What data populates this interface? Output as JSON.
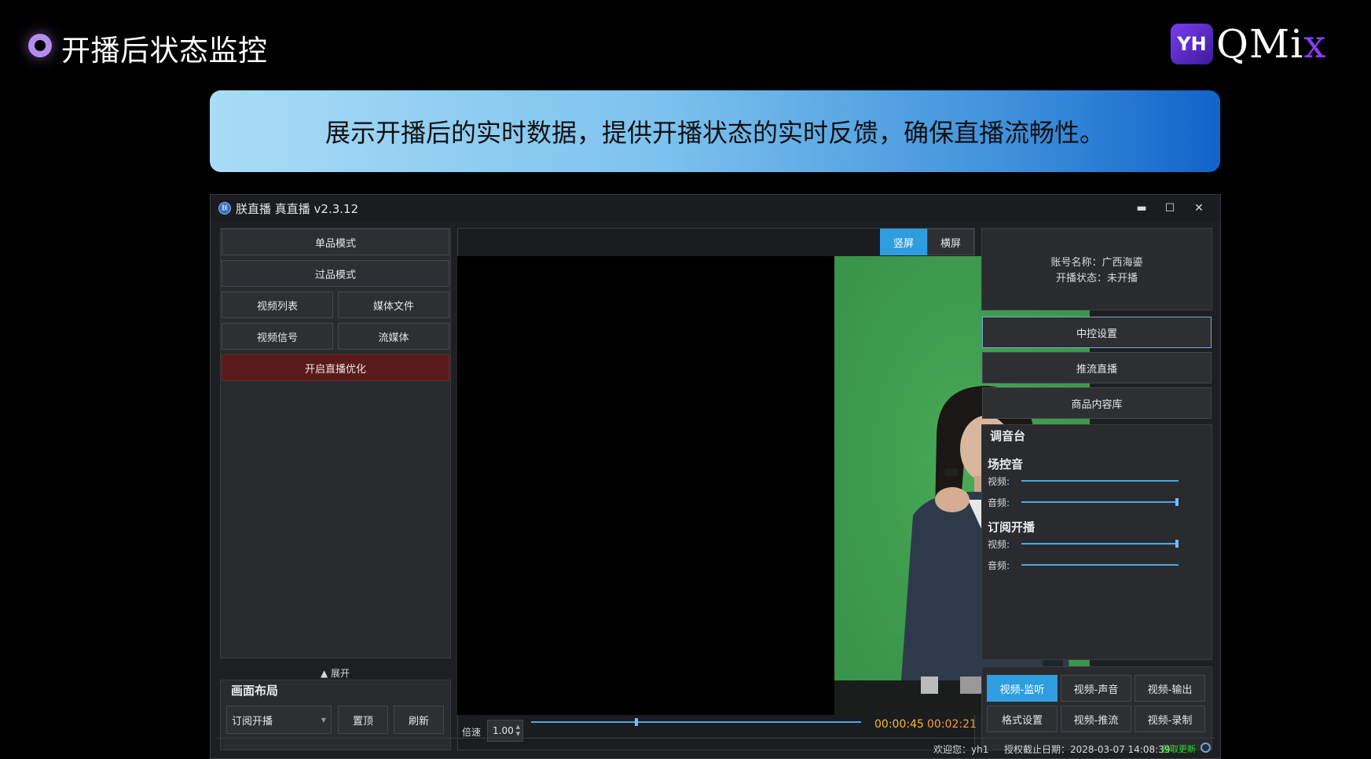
{
  "slide": {
    "title": "开播后状态监控",
    "logo_mark": "YH",
    "logo_text": "QMi",
    "logo_x": "x",
    "banner": "展示开播后的实时数据，提供开播状态的实时反馈，确保直播流畅性。"
  },
  "window": {
    "title": "朕直播 真直播 v2.3.12",
    "icon_label": "朕",
    "minimize": "▬",
    "maximize": "☐",
    "close": "✕"
  },
  "left": {
    "buttons": [
      "单品模式",
      "过品模式",
      "视频列表",
      "媒体文件",
      "视频信号",
      "流媒体",
      "开启直播优化"
    ],
    "expand": "▲ 展开",
    "layout_title": "画面布局",
    "layout_select": "订阅开播",
    "top_button": "置顶",
    "refresh_button": "刷新"
  },
  "center": {
    "tab_portrait": "竖屏",
    "tab_landscape": "横屏",
    "speed_label": "倍速",
    "speed_value": "1.00",
    "time_current": "00:00:45",
    "time_total": "00:02:21",
    "progress": 0.32
  },
  "right": {
    "account_line": "账号名称：广西海鎏",
    "status_line": "开播状态：未开播",
    "buttons": [
      "中控设置",
      "推流直播",
      "商品内容库"
    ],
    "mixer_title": "调音台",
    "groups": [
      {
        "name": "场控音",
        "video_label": "视频:",
        "video_level": 0.0,
        "audio_label": "音频:",
        "audio_level": 1.0
      },
      {
        "name": "订阅开播",
        "video_label": "视频:",
        "video_level": 1.0,
        "audio_label": "音频:",
        "audio_level": 0.0
      }
    ],
    "bottom_buttons": [
      "视频-监听",
      "视频-声音",
      "视频-输出",
      "格式设置",
      "视频-推流",
      "视频-录制"
    ]
  },
  "statusbar": {
    "welcome": "欢迎您：yh1",
    "expiry": "授权截止日期：2028-03-07 14:08:39",
    "update": "获取更新"
  },
  "colors": {
    "accent": "#2f9ee0",
    "time_current": "#f0c020",
    "time_total": "#f0a030",
    "update": "#22dd22",
    "green_screen": "#3f9f4f"
  }
}
